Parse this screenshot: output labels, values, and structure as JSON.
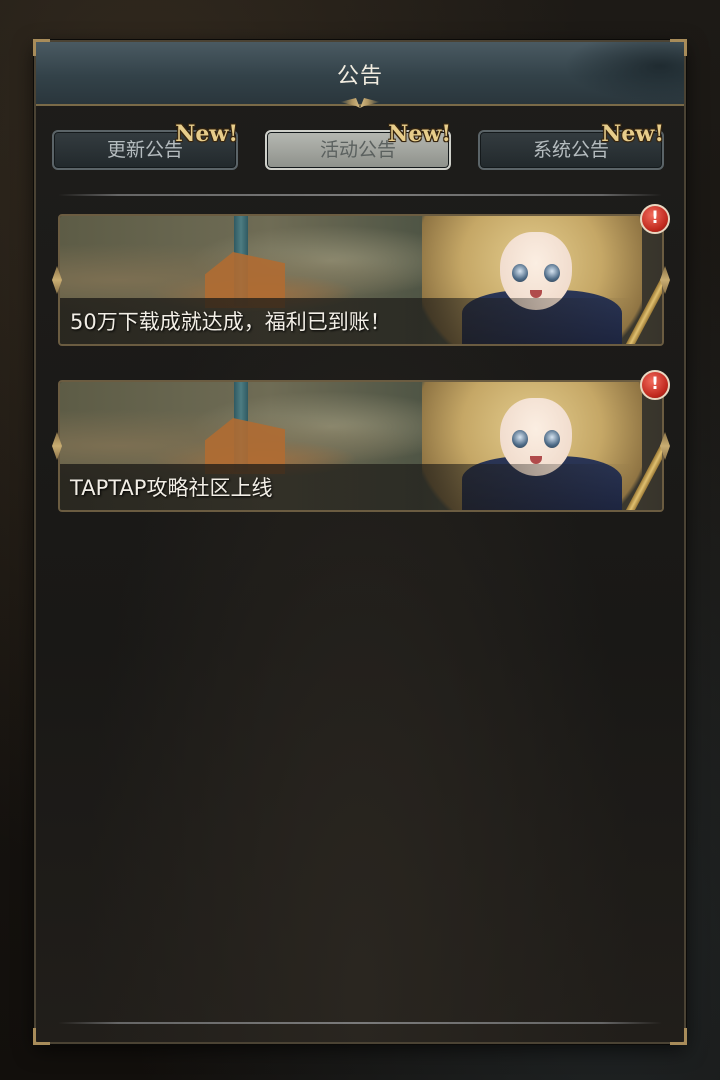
{
  "header": {
    "title": "公告"
  },
  "tabs": [
    {
      "label": "更新公告",
      "badge": "New!",
      "active": false
    },
    {
      "label": "活动公告",
      "badge": "New!",
      "active": true
    },
    {
      "label": "系统公告",
      "badge": "New!",
      "active": false
    }
  ],
  "notices": [
    {
      "title": "50万下载成就达成，福利已到账！",
      "alert": "!"
    },
    {
      "title": "TAPTAP攻略社区上线",
      "alert": "!"
    }
  ],
  "colors": {
    "header_bg": "#334249",
    "active_tab": "#a2a49e",
    "badge_gold": "#e7cd8b",
    "alert_red": "#c0291e"
  }
}
